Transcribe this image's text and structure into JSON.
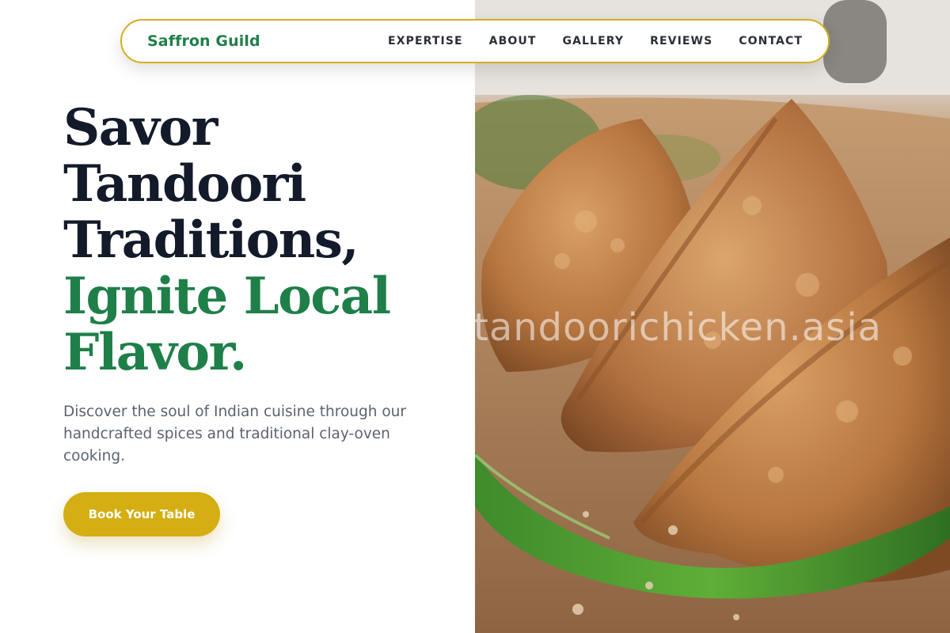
{
  "nav": {
    "brand": "Saffron Guild",
    "links": [
      "EXPERTISE",
      "ABOUT",
      "GALLERY",
      "REVIEWS",
      "CONTACT"
    ]
  },
  "hero": {
    "title_lines_dark": [
      "Savor",
      "Tandoori",
      "Traditions,"
    ],
    "title_lines_green": [
      "Ignite Local",
      "Flavor."
    ],
    "description": "Discover the soul of Indian cuisine through our handcrafted spices and traditional clay-oven cooking.",
    "cta_label": "Book Your Table"
  },
  "image": {
    "watermark": "tandoorichicken.asia",
    "subject": "samosas with green chili on wooden board"
  },
  "colors": {
    "brand_green": "#1f7f49",
    "accent_gold": "#d4ae12",
    "heading_dark": "#131a2a",
    "body_text": "#5b6270"
  }
}
